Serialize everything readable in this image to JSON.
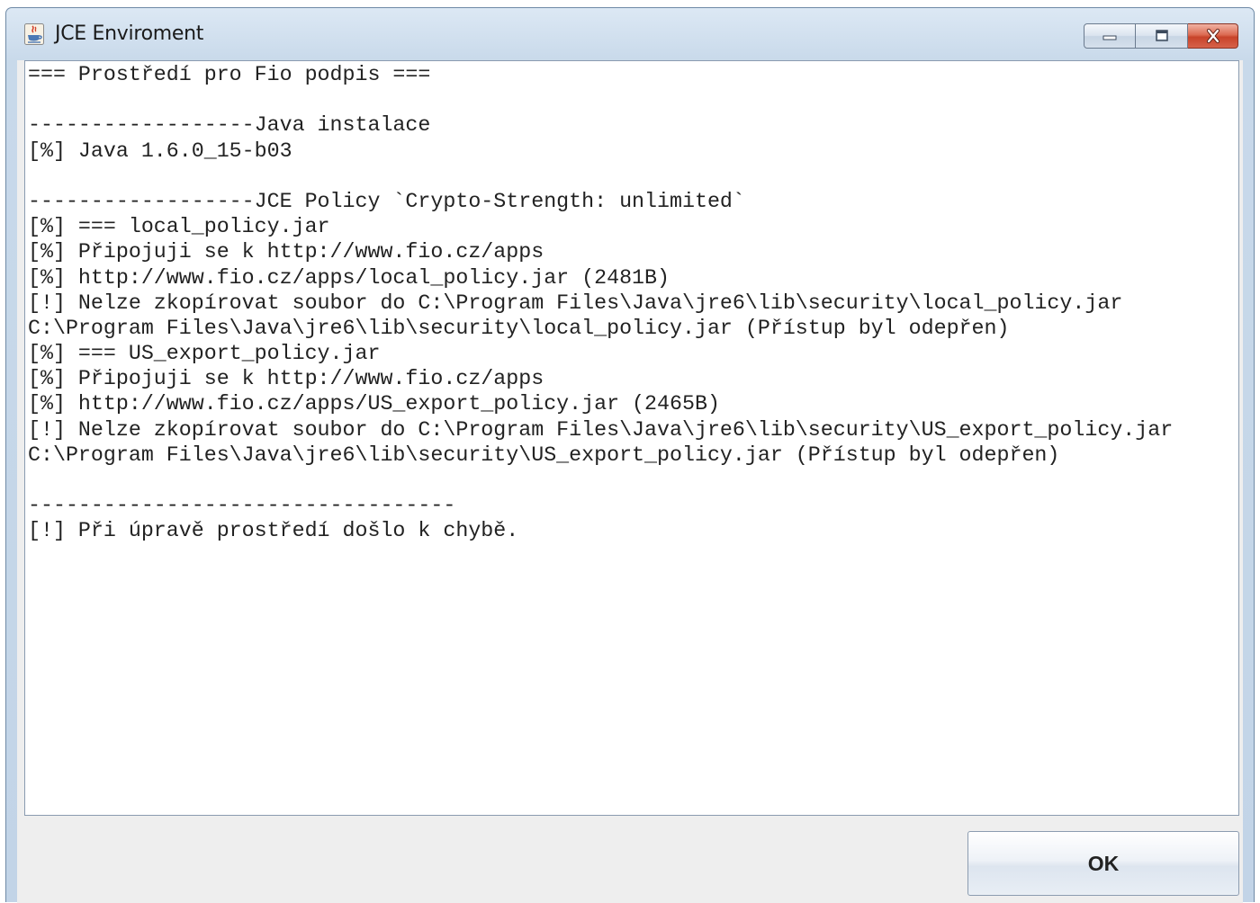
{
  "window": {
    "title": "JCE Enviroment",
    "icon": "java-icon",
    "controls": [
      "minimize-icon",
      "maximize-icon",
      "close-icon"
    ]
  },
  "log": {
    "lines": [
      "=== Prostředí pro Fio podpis ===",
      "",
      "------------------Java instalace",
      "[%] Java 1.6.0_15-b03",
      "",
      "------------------JCE Policy `Crypto-Strength: unlimited`",
      "[%] === local_policy.jar",
      "[%] Připojuji se k http://www.fio.cz/apps",
      "[%] http://www.fio.cz/apps/local_policy.jar (2481B)",
      "[!] Nelze zkopírovat soubor do C:\\Program Files\\Java\\jre6\\lib\\security\\local_policy.jar",
      "C:\\Program Files\\Java\\jre6\\lib\\security\\local_policy.jar (Přístup byl odepřen)",
      "[%] === US_export_policy.jar",
      "[%] Připojuji se k http://www.fio.cz/apps",
      "[%] http://www.fio.cz/apps/US_export_policy.jar (2465B)",
      "[!] Nelze zkopírovat soubor do C:\\Program Files\\Java\\jre6\\lib\\security\\US_export_policy.jar",
      "C:\\Program Files\\Java\\jre6\\lib\\security\\US_export_policy.jar (Přístup byl odepřen)",
      "",
      "----------------------------------",
      "[!] Při úpravě prostředí došlo k chybě."
    ]
  },
  "buttons": {
    "ok_label": "OK"
  },
  "colors": {
    "titlebar": "#c8d9ea",
    "close_button": "#c8432a",
    "log_text": "#222222"
  }
}
